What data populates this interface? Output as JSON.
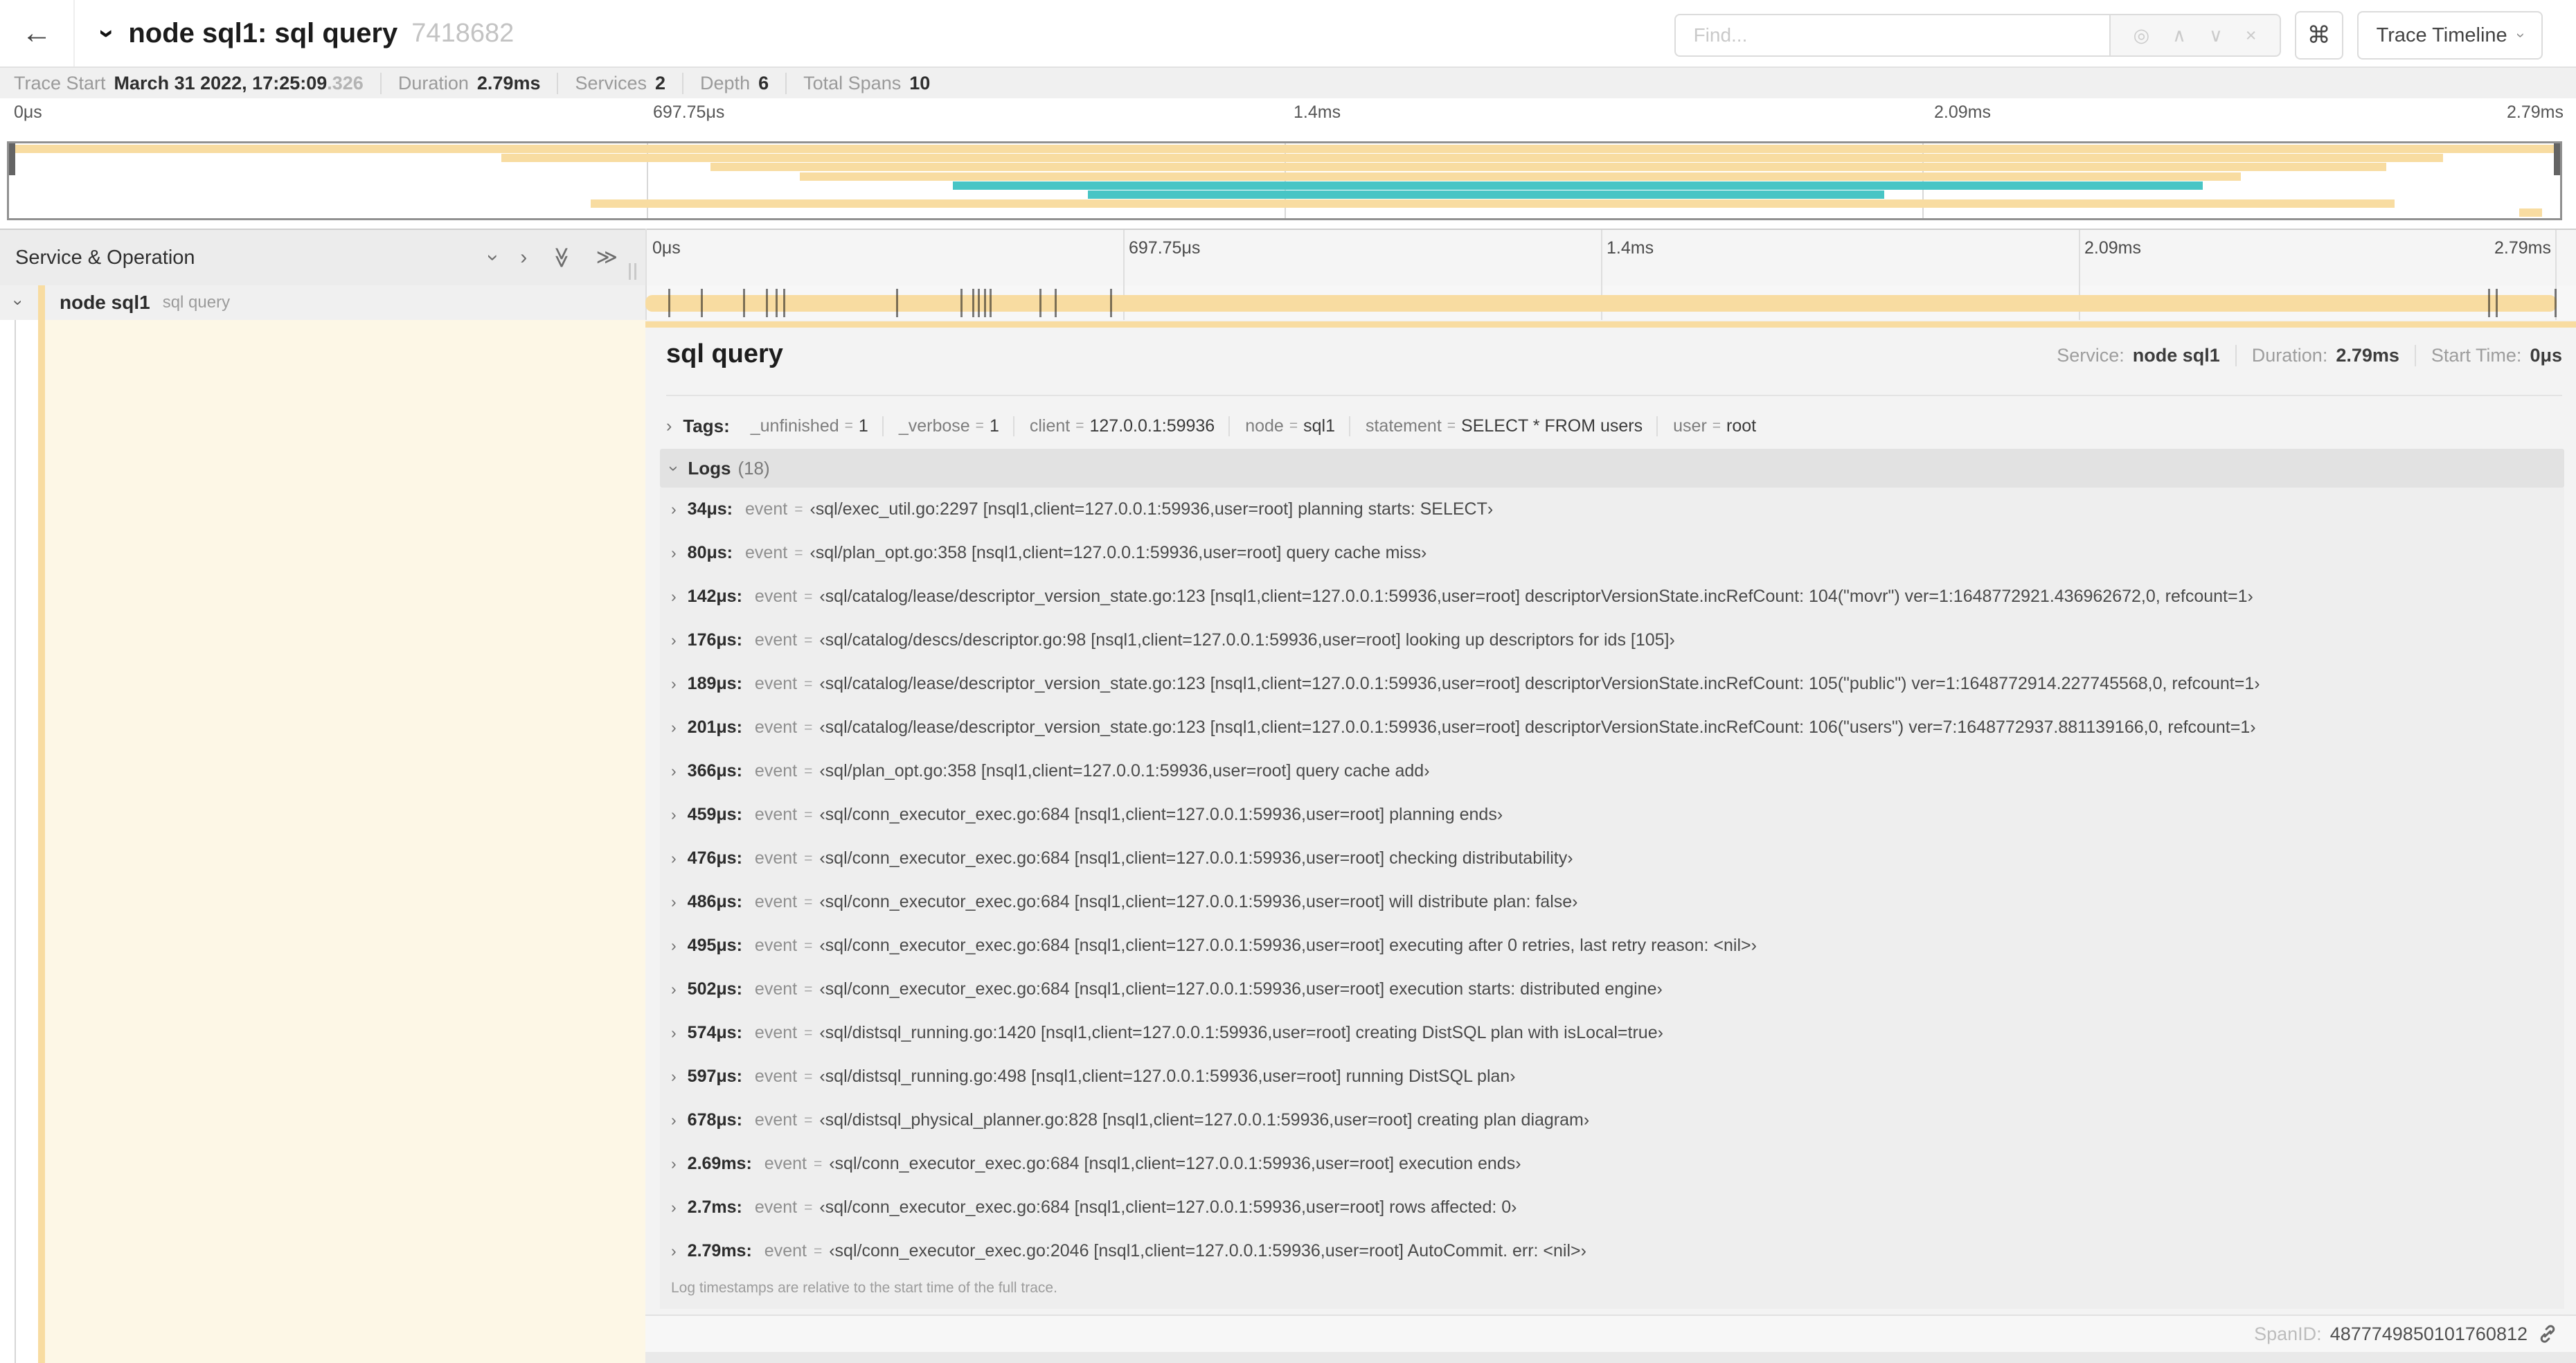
{
  "colors": {
    "span_tan": "#F8DCA1",
    "span_teal": "#48C5C5",
    "accent_tan": "#F8DCA1"
  },
  "header": {
    "back_icon": "←",
    "collapse_icon": "›",
    "title": "node sql1: sql query",
    "trace_id": "7418682",
    "find_placeholder": "Find...",
    "find_icons": [
      {
        "name": "locate-icon",
        "glyph": "◎"
      },
      {
        "name": "prev-result-icon",
        "glyph": "∧"
      },
      {
        "name": "next-result-icon",
        "glyph": "∨"
      },
      {
        "name": "clear-icon",
        "glyph": "×"
      }
    ],
    "shortcut_icon": "⌘",
    "view_selector": "Trace Timeline"
  },
  "trace_meta": {
    "items": [
      {
        "label": "Trace Start",
        "value": "March 31 2022, 17:25:09",
        "suffix": ".326"
      },
      {
        "label": "Duration",
        "value": "2.79ms"
      },
      {
        "label": "Services",
        "value": "2"
      },
      {
        "label": "Depth",
        "value": "6"
      },
      {
        "label": "Total Spans",
        "value": "10"
      }
    ]
  },
  "timeline": {
    "ticks": [
      {
        "label": "0μs",
        "pct": 0
      },
      {
        "label": "697.75μs",
        "pct": 25
      },
      {
        "label": "1.4ms",
        "pct": 50
      },
      {
        "label": "2.09ms",
        "pct": 75
      },
      {
        "label": "2.79ms",
        "pct": 100
      }
    ],
    "minimap_rows": [
      {
        "color": "tan",
        "start": 0,
        "end": 100
      },
      {
        "color": "tan",
        "start": 19.3,
        "end": 95.4
      },
      {
        "color": "tan",
        "start": 27.5,
        "end": 93.2
      },
      {
        "color": "tan",
        "start": 31.0,
        "end": 87.5
      },
      {
        "color": "teal",
        "start": 37.0,
        "end": 86.0
      },
      {
        "color": "teal",
        "start": 42.3,
        "end": 73.5
      },
      {
        "color": "tan",
        "start": 22.8,
        "end": 93.5
      },
      {
        "color": "tan",
        "start": 98.4,
        "end": 99.3
      }
    ]
  },
  "left_header": {
    "title": "Service & Operation",
    "buttons": [
      {
        "name": "collapse-one-icon",
        "glyph": "›",
        "rotate": true
      },
      {
        "name": "expand-one-icon",
        "glyph": "›",
        "rotate": false
      },
      {
        "name": "collapse-all-icon",
        "glyph": "≫",
        "rotate": true
      },
      {
        "name": "expand-all-icon",
        "glyph": "≫",
        "rotate": false
      }
    ]
  },
  "span_row": {
    "service": "node sql1",
    "operation": "sql query",
    "bar_start_pct": 0,
    "bar_end_pct": 100,
    "log_marker_pcts": [
      1.2,
      2.9,
      5.1,
      6.3,
      6.8,
      7.2,
      13.1,
      16.5,
      17.1,
      17.4,
      17.7,
      18.0,
      20.6,
      21.4,
      24.3,
      96.4,
      96.8,
      99.9
    ]
  },
  "detail": {
    "title": "sql query",
    "overview": [
      {
        "label": "Service:",
        "value": "node sql1"
      },
      {
        "label": "Duration:",
        "value": "2.79ms"
      },
      {
        "label": "Start Time:",
        "value": "0μs"
      }
    ],
    "tags_label": "Tags:",
    "tags": [
      {
        "key": "_unfinished",
        "value": "1"
      },
      {
        "key": "_verbose",
        "value": "1"
      },
      {
        "key": "client",
        "value": "127.0.0.1:59936"
      },
      {
        "key": "node",
        "value": "sql1"
      },
      {
        "key": "statement",
        "value": "SELECT * FROM users"
      },
      {
        "key": "user",
        "value": "root"
      }
    ],
    "logs_label": "Logs",
    "logs_count": "(18)",
    "log_entries": [
      {
        "time": "34μs:",
        "key": "event",
        "value": "‹sql/exec_util.go:2297 [nsql1,client=127.0.0.1:59936,user=root] planning starts: SELECT›"
      },
      {
        "time": "80μs:",
        "key": "event",
        "value": "‹sql/plan_opt.go:358 [nsql1,client=127.0.0.1:59936,user=root] query cache miss›"
      },
      {
        "time": "142μs:",
        "key": "event",
        "value": "‹sql/catalog/lease/descriptor_version_state.go:123 [nsql1,client=127.0.0.1:59936,user=root] descriptorVersionState.incRefCount: 104(\"movr\") ver=1:1648772921.436962672,0, refcount=1›"
      },
      {
        "time": "176μs:",
        "key": "event",
        "value": "‹sql/catalog/descs/descriptor.go:98 [nsql1,client=127.0.0.1:59936,user=root] looking up descriptors for ids [105]›"
      },
      {
        "time": "189μs:",
        "key": "event",
        "value": "‹sql/catalog/lease/descriptor_version_state.go:123 [nsql1,client=127.0.0.1:59936,user=root] descriptorVersionState.incRefCount: 105(\"public\") ver=1:1648772914.227745568,0, refcount=1›"
      },
      {
        "time": "201μs:",
        "key": "event",
        "value": "‹sql/catalog/lease/descriptor_version_state.go:123 [nsql1,client=127.0.0.1:59936,user=root] descriptorVersionState.incRefCount: 106(\"users\") ver=7:1648772937.881139166,0, refcount=1›"
      },
      {
        "time": "366μs:",
        "key": "event",
        "value": "‹sql/plan_opt.go:358 [nsql1,client=127.0.0.1:59936,user=root] query cache add›"
      },
      {
        "time": "459μs:",
        "key": "event",
        "value": "‹sql/conn_executor_exec.go:684 [nsql1,client=127.0.0.1:59936,user=root] planning ends›"
      },
      {
        "time": "476μs:",
        "key": "event",
        "value": "‹sql/conn_executor_exec.go:684 [nsql1,client=127.0.0.1:59936,user=root] checking distributability›"
      },
      {
        "time": "486μs:",
        "key": "event",
        "value": "‹sql/conn_executor_exec.go:684 [nsql1,client=127.0.0.1:59936,user=root] will distribute plan: false›"
      },
      {
        "time": "495μs:",
        "key": "event",
        "value": "‹sql/conn_executor_exec.go:684 [nsql1,client=127.0.0.1:59936,user=root] executing after 0 retries, last retry reason: <nil>›"
      },
      {
        "time": "502μs:",
        "key": "event",
        "value": "‹sql/conn_executor_exec.go:684 [nsql1,client=127.0.0.1:59936,user=root] execution starts: distributed engine›"
      },
      {
        "time": "574μs:",
        "key": "event",
        "value": "‹sql/distsql_running.go:1420 [nsql1,client=127.0.0.1:59936,user=root] creating DistSQL plan with isLocal=true›"
      },
      {
        "time": "597μs:",
        "key": "event",
        "value": "‹sql/distsql_running.go:498 [nsql1,client=127.0.0.1:59936,user=root] running DistSQL plan›"
      },
      {
        "time": "678μs:",
        "key": "event",
        "value": "‹sql/distsql_physical_planner.go:828 [nsql1,client=127.0.0.1:59936,user=root] creating plan diagram›"
      },
      {
        "time": "2.69ms:",
        "key": "event",
        "value": "‹sql/conn_executor_exec.go:684 [nsql1,client=127.0.0.1:59936,user=root] execution ends›"
      },
      {
        "time": "2.7ms:",
        "key": "event",
        "value": "‹sql/conn_executor_exec.go:684 [nsql1,client=127.0.0.1:59936,user=root] rows affected: 0›"
      },
      {
        "time": "2.79ms:",
        "key": "event",
        "value": "‹sql/conn_executor_exec.go:2046 [nsql1,client=127.0.0.1:59936,user=root] AutoCommit. err: <nil>›"
      }
    ],
    "logs_note": "Log timestamps are relative to the start time of the full trace.",
    "footer_label": "SpanID:",
    "footer_value": "4877749850101760812"
  }
}
